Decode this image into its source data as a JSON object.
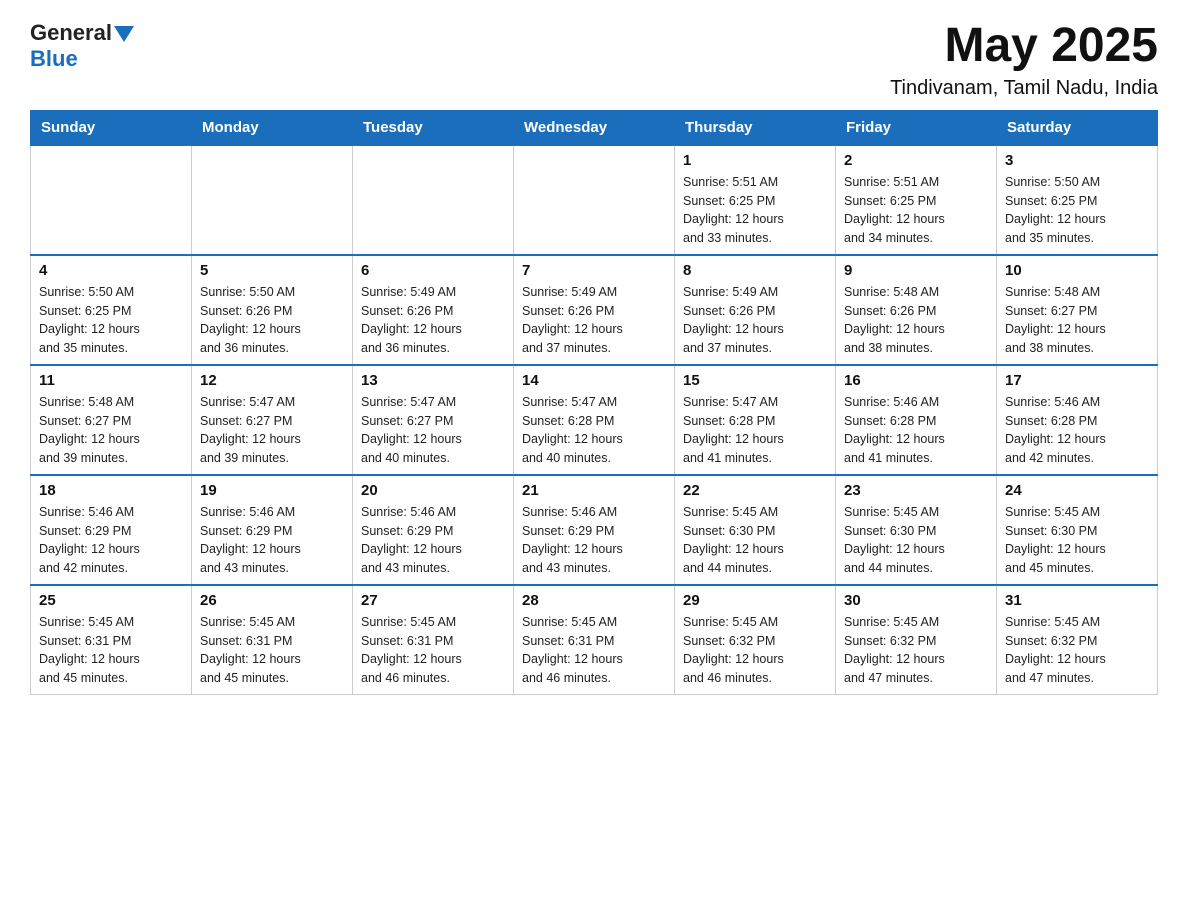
{
  "logo": {
    "text_general": "General",
    "text_blue": "Blue"
  },
  "header": {
    "month_year": "May 2025",
    "location": "Tindivanam, Tamil Nadu, India"
  },
  "days_of_week": [
    "Sunday",
    "Monday",
    "Tuesday",
    "Wednesday",
    "Thursday",
    "Friday",
    "Saturday"
  ],
  "weeks": [
    [
      {
        "day": "",
        "info": ""
      },
      {
        "day": "",
        "info": ""
      },
      {
        "day": "",
        "info": ""
      },
      {
        "day": "",
        "info": ""
      },
      {
        "day": "1",
        "info": "Sunrise: 5:51 AM\nSunset: 6:25 PM\nDaylight: 12 hours\nand 33 minutes."
      },
      {
        "day": "2",
        "info": "Sunrise: 5:51 AM\nSunset: 6:25 PM\nDaylight: 12 hours\nand 34 minutes."
      },
      {
        "day": "3",
        "info": "Sunrise: 5:50 AM\nSunset: 6:25 PM\nDaylight: 12 hours\nand 35 minutes."
      }
    ],
    [
      {
        "day": "4",
        "info": "Sunrise: 5:50 AM\nSunset: 6:25 PM\nDaylight: 12 hours\nand 35 minutes."
      },
      {
        "day": "5",
        "info": "Sunrise: 5:50 AM\nSunset: 6:26 PM\nDaylight: 12 hours\nand 36 minutes."
      },
      {
        "day": "6",
        "info": "Sunrise: 5:49 AM\nSunset: 6:26 PM\nDaylight: 12 hours\nand 36 minutes."
      },
      {
        "day": "7",
        "info": "Sunrise: 5:49 AM\nSunset: 6:26 PM\nDaylight: 12 hours\nand 37 minutes."
      },
      {
        "day": "8",
        "info": "Sunrise: 5:49 AM\nSunset: 6:26 PM\nDaylight: 12 hours\nand 37 minutes."
      },
      {
        "day": "9",
        "info": "Sunrise: 5:48 AM\nSunset: 6:26 PM\nDaylight: 12 hours\nand 38 minutes."
      },
      {
        "day": "10",
        "info": "Sunrise: 5:48 AM\nSunset: 6:27 PM\nDaylight: 12 hours\nand 38 minutes."
      }
    ],
    [
      {
        "day": "11",
        "info": "Sunrise: 5:48 AM\nSunset: 6:27 PM\nDaylight: 12 hours\nand 39 minutes."
      },
      {
        "day": "12",
        "info": "Sunrise: 5:47 AM\nSunset: 6:27 PM\nDaylight: 12 hours\nand 39 minutes."
      },
      {
        "day": "13",
        "info": "Sunrise: 5:47 AM\nSunset: 6:27 PM\nDaylight: 12 hours\nand 40 minutes."
      },
      {
        "day": "14",
        "info": "Sunrise: 5:47 AM\nSunset: 6:28 PM\nDaylight: 12 hours\nand 40 minutes."
      },
      {
        "day": "15",
        "info": "Sunrise: 5:47 AM\nSunset: 6:28 PM\nDaylight: 12 hours\nand 41 minutes."
      },
      {
        "day": "16",
        "info": "Sunrise: 5:46 AM\nSunset: 6:28 PM\nDaylight: 12 hours\nand 41 minutes."
      },
      {
        "day": "17",
        "info": "Sunrise: 5:46 AM\nSunset: 6:28 PM\nDaylight: 12 hours\nand 42 minutes."
      }
    ],
    [
      {
        "day": "18",
        "info": "Sunrise: 5:46 AM\nSunset: 6:29 PM\nDaylight: 12 hours\nand 42 minutes."
      },
      {
        "day": "19",
        "info": "Sunrise: 5:46 AM\nSunset: 6:29 PM\nDaylight: 12 hours\nand 43 minutes."
      },
      {
        "day": "20",
        "info": "Sunrise: 5:46 AM\nSunset: 6:29 PM\nDaylight: 12 hours\nand 43 minutes."
      },
      {
        "day": "21",
        "info": "Sunrise: 5:46 AM\nSunset: 6:29 PM\nDaylight: 12 hours\nand 43 minutes."
      },
      {
        "day": "22",
        "info": "Sunrise: 5:45 AM\nSunset: 6:30 PM\nDaylight: 12 hours\nand 44 minutes."
      },
      {
        "day": "23",
        "info": "Sunrise: 5:45 AM\nSunset: 6:30 PM\nDaylight: 12 hours\nand 44 minutes."
      },
      {
        "day": "24",
        "info": "Sunrise: 5:45 AM\nSunset: 6:30 PM\nDaylight: 12 hours\nand 45 minutes."
      }
    ],
    [
      {
        "day": "25",
        "info": "Sunrise: 5:45 AM\nSunset: 6:31 PM\nDaylight: 12 hours\nand 45 minutes."
      },
      {
        "day": "26",
        "info": "Sunrise: 5:45 AM\nSunset: 6:31 PM\nDaylight: 12 hours\nand 45 minutes."
      },
      {
        "day": "27",
        "info": "Sunrise: 5:45 AM\nSunset: 6:31 PM\nDaylight: 12 hours\nand 46 minutes."
      },
      {
        "day": "28",
        "info": "Sunrise: 5:45 AM\nSunset: 6:31 PM\nDaylight: 12 hours\nand 46 minutes."
      },
      {
        "day": "29",
        "info": "Sunrise: 5:45 AM\nSunset: 6:32 PM\nDaylight: 12 hours\nand 46 minutes."
      },
      {
        "day": "30",
        "info": "Sunrise: 5:45 AM\nSunset: 6:32 PM\nDaylight: 12 hours\nand 47 minutes."
      },
      {
        "day": "31",
        "info": "Sunrise: 5:45 AM\nSunset: 6:32 PM\nDaylight: 12 hours\nand 47 minutes."
      }
    ]
  ]
}
